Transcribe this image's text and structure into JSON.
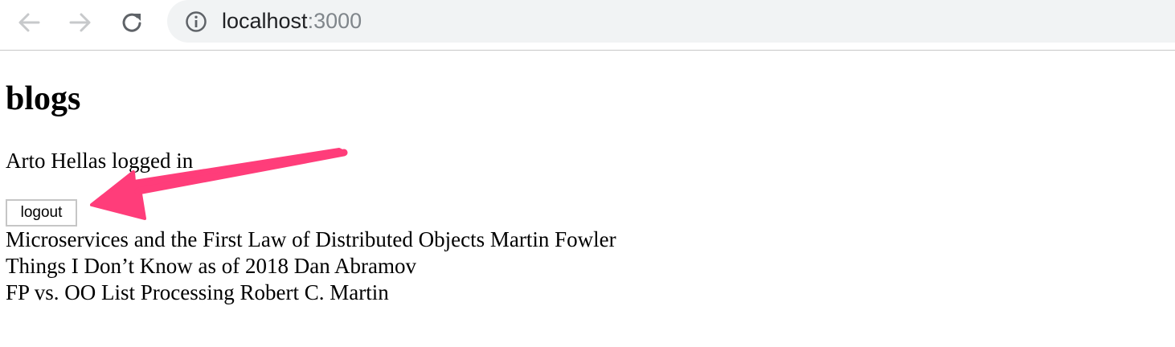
{
  "browser": {
    "url_host": "localhost",
    "url_port": ":3000",
    "icons": {
      "back": "back-arrow-icon",
      "forward": "forward-arrow-icon",
      "reload": "reload-icon",
      "info": "info-icon"
    }
  },
  "page": {
    "title": "blogs",
    "logged_in_text": "Arto Hellas logged in",
    "logout_label": "logout",
    "blogs": [
      "Microservices and the First Law of Distributed Objects Martin Fowler",
      "Things I Don’t Know as of 2018 Dan Abramov",
      "FP vs. OO List Processing Robert C. Martin"
    ]
  },
  "colors": {
    "annotation_arrow": "#ff3d7a",
    "omnibox_bg": "#f1f3f4",
    "toolbar_icon": "#5f6368"
  }
}
